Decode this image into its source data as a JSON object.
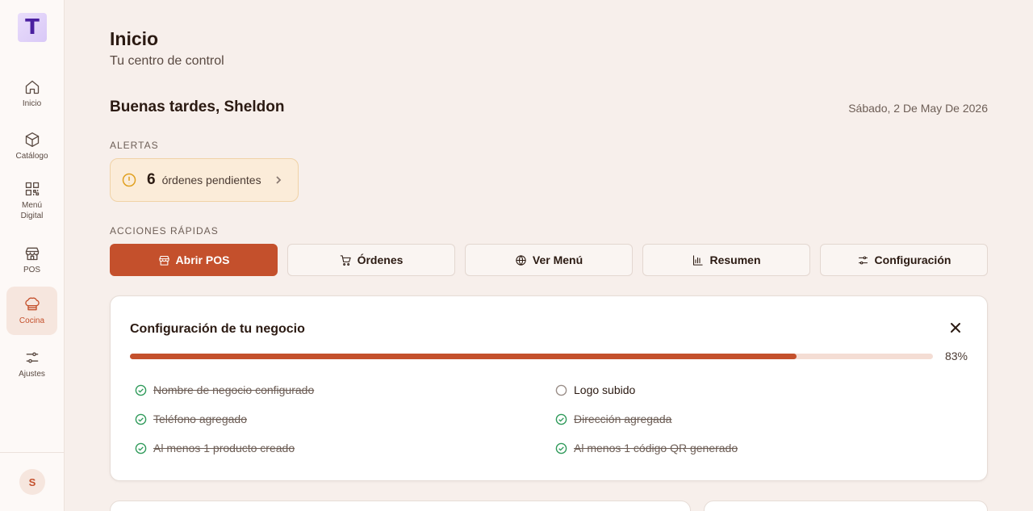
{
  "app": {
    "logo_letter": "T"
  },
  "sidebar": {
    "items": [
      {
        "label": "Inicio",
        "icon": "home-icon",
        "active": false
      },
      {
        "label": "Catálogo",
        "icon": "box-icon",
        "active": false
      },
      {
        "label": "Menú Digital",
        "icon": "qr-code-icon",
        "active": false
      },
      {
        "label": "POS",
        "icon": "store-icon",
        "active": false
      },
      {
        "label": "Cocina",
        "icon": "chef-hat-icon",
        "active": true
      },
      {
        "label": "Ajustes",
        "icon": "sliders-icon",
        "active": false
      }
    ],
    "avatar_initial": "S"
  },
  "header": {
    "title": "Inicio",
    "subtitle": "Tu centro de control",
    "greeting": "Buenas tardes, Sheldon",
    "date": "Sábado, 2 De May De 2026"
  },
  "alerts": {
    "label": "ALERTAS",
    "items": [
      {
        "count": "6",
        "text": "órdenes pendientes",
        "icon": "alert-circle-icon"
      }
    ]
  },
  "quick_actions": {
    "label": "ACCIONES RÁPIDAS",
    "items": [
      {
        "label": "Abrir POS",
        "icon": "store-icon",
        "primary": true
      },
      {
        "label": "Órdenes",
        "icon": "cart-icon",
        "primary": false
      },
      {
        "label": "Ver Menú",
        "icon": "globe-icon",
        "primary": false
      },
      {
        "label": "Resumen",
        "icon": "bar-chart-icon",
        "primary": false
      },
      {
        "label": "Configuración",
        "icon": "sliders-icon",
        "primary": false
      }
    ]
  },
  "setup": {
    "title": "Configuración de tu negocio",
    "progress_percent": 83,
    "progress_label": "83%",
    "checklist": [
      {
        "label": "Nombre de negocio configurado",
        "done": true
      },
      {
        "label": "Logo subido",
        "done": false
      },
      {
        "label": "Teléfono agregado",
        "done": true
      },
      {
        "label": "Dirección agregada",
        "done": true
      },
      {
        "label": "Al menos 1 producto creado",
        "done": true
      },
      {
        "label": "Al menos 1 código QR generado",
        "done": true
      }
    ]
  },
  "colors": {
    "accent": "#c4502c",
    "background": "#f7efeb",
    "success": "#2f9a5a",
    "warning": "#e0a020"
  }
}
